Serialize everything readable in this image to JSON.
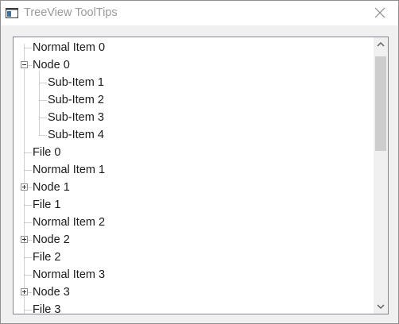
{
  "window": {
    "title": "TreeView ToolTips"
  },
  "icons": {
    "app": "window-icon",
    "close": "close-icon",
    "scroll_up": "chevron-up-icon",
    "scroll_down": "chevron-down-icon"
  },
  "tree": {
    "items": [
      {
        "label": "Normal Item 0",
        "level": 0
      },
      {
        "label": "Node 0",
        "level": 0,
        "expander": "expanded"
      },
      {
        "label": "Sub-Item 1",
        "level": 1
      },
      {
        "label": "Sub-Item 2",
        "level": 1
      },
      {
        "label": "Sub-Item 3",
        "level": 1
      },
      {
        "label": "Sub-Item 4",
        "level": 1
      },
      {
        "label": "File 0",
        "level": 0
      },
      {
        "label": "Normal Item 1",
        "level": 0
      },
      {
        "label": "Node 1",
        "level": 0,
        "expander": "collapsed"
      },
      {
        "label": "File 1",
        "level": 0
      },
      {
        "label": "Normal Item 2",
        "level": 0
      },
      {
        "label": "Node 2",
        "level": 0,
        "expander": "collapsed"
      },
      {
        "label": "File 2",
        "level": 0
      },
      {
        "label": "Normal Item 3",
        "level": 0
      },
      {
        "label": "Node 3",
        "level": 0,
        "expander": "collapsed"
      },
      {
        "label": "File 3",
        "level": 0
      }
    ]
  },
  "colors": {
    "title_text": "#9a9a9a",
    "scroll_thumb": "#cdcdcd"
  }
}
